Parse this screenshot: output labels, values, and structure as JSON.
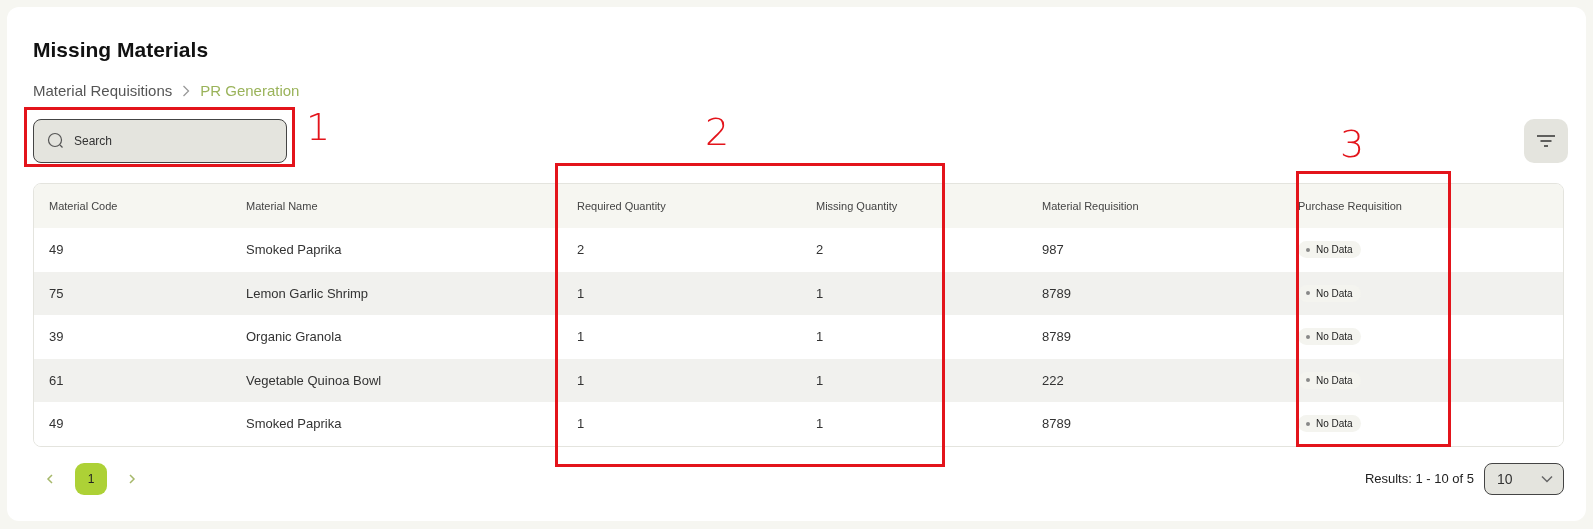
{
  "page": {
    "title": "Missing Materials"
  },
  "breadcrumb": [
    {
      "label": "Material Requisitions",
      "selected": false
    },
    {
      "label": "PR Generation",
      "selected": true
    }
  ],
  "search": {
    "placeholder": "Search"
  },
  "table": {
    "columns": [
      "Material Code",
      "Material Name",
      "Required Quantity",
      "Missing Quantity",
      "Material Requisition",
      "Purchase Requisition"
    ],
    "rows": [
      {
        "cells": [
          "49",
          "Smoked Paprika",
          "2",
          "2",
          "987"
        ],
        "status": "No Data"
      },
      {
        "cells": [
          "75",
          "Lemon Garlic Shrimp",
          "1",
          "1",
          "8789"
        ],
        "status": "No Data"
      },
      {
        "cells": [
          "39",
          "Organic Granola",
          "1",
          "1",
          "8789"
        ],
        "status": "No Data"
      },
      {
        "cells": [
          "61",
          "Vegetable Quinoa Bowl",
          "1",
          "1",
          "222"
        ],
        "status": "No Data"
      },
      {
        "cells": [
          "49",
          "Smoked Paprika",
          "1",
          "1",
          "8789"
        ],
        "status": "No Data"
      }
    ]
  },
  "pagination": {
    "pages": [
      {
        "label": "1",
        "selected": true
      }
    ],
    "results": "Results: 1 - 10 of 5",
    "page_size": "10"
  },
  "annotations": [
    {
      "label": "1"
    },
    {
      "label": "2"
    },
    {
      "label": "3"
    }
  ]
}
